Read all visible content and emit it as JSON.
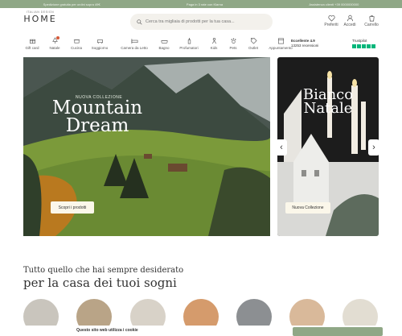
{
  "topbar": {
    "left": "Spedizione gratuita per ordini sopra 49€",
    "center": "Paga in 3 rate con Klarna",
    "right": "Assistenza clienti +39 0000000000"
  },
  "logo": {
    "small": "ITALIAN DESIGN",
    "big": "HOME"
  },
  "search": {
    "placeholder": "Cerca tra migliaia di prodotti per la tua casa..."
  },
  "header_icons": [
    {
      "label": "Preferiti",
      "icon": "heart-icon"
    },
    {
      "label": "Accedi",
      "icon": "user-icon"
    },
    {
      "label": "Carrello",
      "icon": "cart-icon"
    }
  ],
  "nav": [
    {
      "label": "Gift card",
      "icon": "gift-icon"
    },
    {
      "label": "Natale",
      "icon": "tree-icon"
    },
    {
      "label": "Cucina",
      "icon": "pot-icon"
    },
    {
      "label": "Soggiorno",
      "icon": "sofa-icon"
    },
    {
      "label": "Camera da Letto",
      "icon": "bed-icon"
    },
    {
      "label": "Bagno",
      "icon": "bath-icon"
    },
    {
      "label": "Profumatori",
      "icon": "candle-icon"
    },
    {
      "label": "Kids",
      "icon": "kids-icon"
    },
    {
      "label": "Pets",
      "icon": "paw-icon"
    },
    {
      "label": "Outlet",
      "icon": "tag-icon"
    },
    {
      "label": "Appuntamento",
      "icon": "calendar-icon"
    }
  ],
  "trust": {
    "rating": "Eccellente 4.9",
    "reviews": "13253 recensioni",
    "brand": "Trustpilot",
    "color": "#00b67a"
  },
  "hero": {
    "kicker": "NUOVA COLLEZIONE",
    "title": "Mountain Dream",
    "cta": "Scopri i prodotti"
  },
  "side": {
    "title": "Bianco Natale",
    "cta": "Nuova Collezione"
  },
  "tagline": {
    "line1": "Tutto quello che hai sempre desiderato",
    "line2": "per la casa dei tuoi sogni"
  },
  "cookie": {
    "text": "Questo sito web utilizza i cookie"
  },
  "colors": {
    "accent": "#8fa786"
  }
}
